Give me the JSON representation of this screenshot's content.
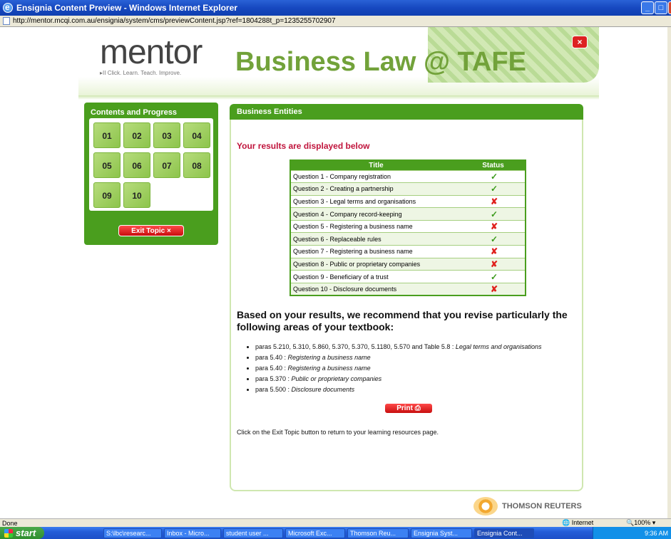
{
  "window": {
    "title": "Ensignia Content Preview - Windows Internet Explorer",
    "url": "http://mentor.mcqi.com.au/ensignia/system/cms/previewContent.jsp?ref=1804288t_p=1235255702907"
  },
  "header": {
    "logo": "mentor",
    "tagline": "Click. Learn. Teach. Improve.",
    "course_title": "Business Law @ TAFE",
    "close_label": "×"
  },
  "sidebar": {
    "title": "Contents and Progress",
    "tiles": [
      "01",
      "02",
      "03",
      "04",
      "05",
      "06",
      "07",
      "08",
      "09",
      "10"
    ],
    "exit_label": "Exit Topic ×"
  },
  "main": {
    "section_title": "Business Entities",
    "results_heading": "Your results are displayed below",
    "table": {
      "headers": [
        "Title",
        "Status"
      ],
      "rows": [
        {
          "title": "Question 1 - Company registration",
          "status": "✓",
          "correct": true
        },
        {
          "title": "Question 2 - Creating a partnership",
          "status": "✓",
          "correct": true
        },
        {
          "title": "Question 3 - Legal terms and organisations",
          "status": "✘",
          "correct": false
        },
        {
          "title": "Question 4 - Company record-keeping",
          "status": "✓",
          "correct": true
        },
        {
          "title": "Question 5 - Registering a business name",
          "status": "✘",
          "correct": false
        },
        {
          "title": "Question 6 - Replaceable rules",
          "status": "✓",
          "correct": true
        },
        {
          "title": "Question 7 - Registering a business name",
          "status": "✘",
          "correct": false
        },
        {
          "title": "Question 8 - Public or proprietary companies",
          "status": "✘",
          "correct": false
        },
        {
          "title": "Question 9 - Beneficiary of a trust",
          "status": "✓",
          "correct": true
        },
        {
          "title": "Question 10 - Disclosure documents",
          "status": "✘",
          "correct": false
        }
      ]
    },
    "recommend_heading": "Based on your results, we recommend that you revise particularly the following areas of your textbook:",
    "areas": [
      {
        "ref": "paras 5.210, 5.310, 5.860, 5.370, 5.370, 5.1180, 5.570 and Table 5.8 : ",
        "topic": "Legal terms and organisations"
      },
      {
        "ref": "para 5.40 : ",
        "topic": "Registering a business name"
      },
      {
        "ref": "para 5.40 : ",
        "topic": "Registering a business name"
      },
      {
        "ref": "para 5.370 : ",
        "topic": "Public or proprietary companies"
      },
      {
        "ref": "para 5.500 : ",
        "topic": "Disclosure documents"
      }
    ],
    "print_label": "Print",
    "note": "Click on the Exit Topic button to return to your learning resources page."
  },
  "footer_logo": "THOMSON REUTERS",
  "status": {
    "left": "Done",
    "zone": "Internet",
    "zoom": "100%"
  },
  "taskbar": {
    "start": "start",
    "tasks": [
      "S:\\lbc\\researc...",
      "Inbox - Micro...",
      "student user ...",
      "Microsoft Exc...",
      "Thomson Reu...",
      "Ensignia Syst...",
      "Ensignia Cont..."
    ],
    "clock": "9:36 AM"
  }
}
